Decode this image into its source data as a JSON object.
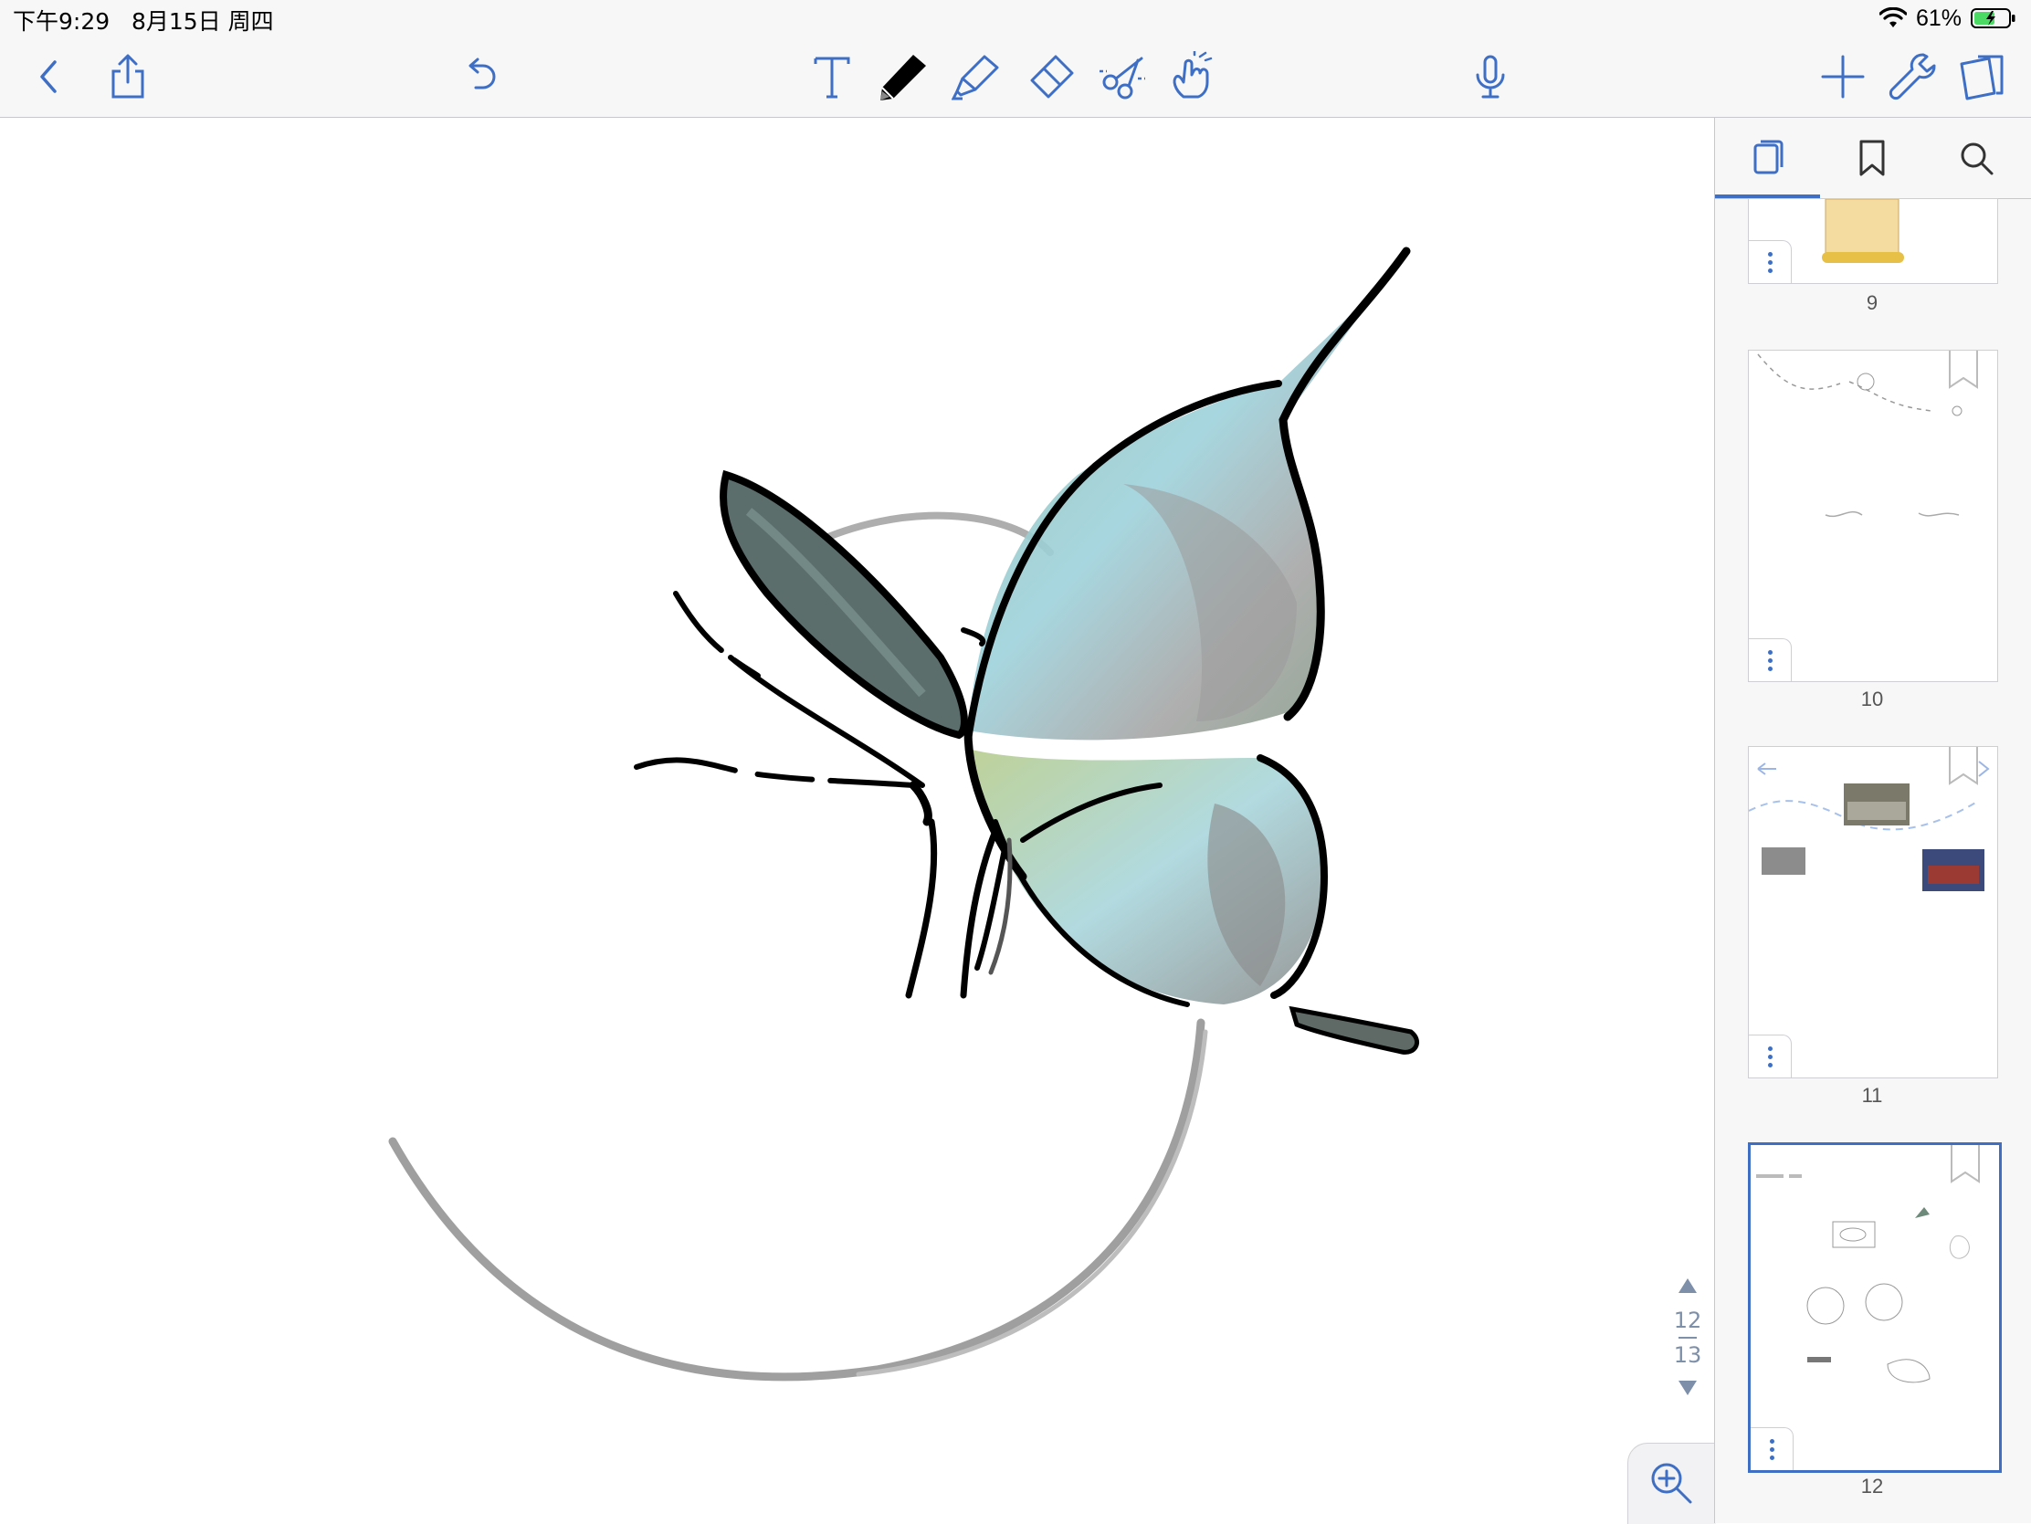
{
  "status_bar": {
    "time": "下午9:29",
    "date": "8月15日 周四",
    "battery_percent": "61%",
    "battery_level": 0.61
  },
  "toolbar": {
    "accent_color": "#3e6fc4",
    "tools": [
      "back-icon",
      "share-icon",
      "undo-icon",
      "text-tool-icon",
      "pen-tool-icon",
      "highlighter-icon",
      "eraser-icon",
      "lasso-scissors-icon",
      "hand-pointer-icon",
      "microphone-icon",
      "add-icon",
      "wrench-icon",
      "pages-icon"
    ],
    "active_tool": "pen-tool-icon"
  },
  "sidebar": {
    "tabs": [
      "thumbnails-icon",
      "bookmark-icon",
      "search-icon"
    ],
    "active_tab": "thumbnails-icon",
    "pages": [
      {
        "label": "9"
      },
      {
        "label": "10"
      },
      {
        "label": "11"
      },
      {
        "label": "12",
        "selected": true
      }
    ]
  },
  "page_nav": {
    "current": "12",
    "total": "13"
  },
  "canvas": {
    "drawing": "butterfly sketch with circle"
  }
}
